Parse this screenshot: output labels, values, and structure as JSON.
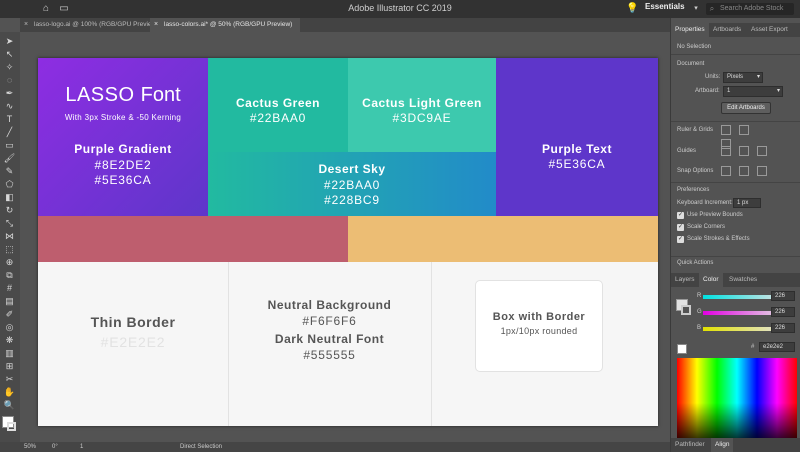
{
  "window": {
    "title": "Adobe Illustrator CC 2019",
    "workspace": "Essentials",
    "search_placeholder": "Search Adobe Stock"
  },
  "doc_tabs": [
    {
      "label": "lasso-logo.ai @ 100% (RGB/GPU Preview)",
      "active": false
    },
    {
      "label": "lasso-colors.ai* @ 50% (RGB/GPU Preview)",
      "active": true
    }
  ],
  "artboard": {
    "purple_gradient": {
      "logo": "LASSO Font",
      "logo_main": "LASSO",
      "logo_sub": "Font",
      "tagline": "With 3px Stroke & -50 Kerning",
      "label": "Purple Gradient",
      "hex1": "#8E2DE2",
      "hex2": "#5E36CA"
    },
    "cactus_green": {
      "label": "Cactus Green",
      "hex": "#22BAA0"
    },
    "cactus_light_green": {
      "label": "Cactus Light Green",
      "hex": "#3DC9AE"
    },
    "desert_sky": {
      "label": "Desert Sky",
      "hex1": "#22BAA0",
      "hex2": "#228BC9"
    },
    "purple_text": {
      "label": "Purple Text",
      "hex": "#5E36CA"
    },
    "thin_border": {
      "label": "Thin Border",
      "hex": "#E2E2E2"
    },
    "neutral": {
      "label1": "Neutral Background",
      "hex1": "#F6F6F6",
      "label2": "Dark Neutral Font",
      "hex2": "#555555"
    },
    "box_border": {
      "label": "Box with Border",
      "spec": "1px/10px rounded"
    }
  },
  "status": {
    "zoom": "50%",
    "angle": "0°",
    "artboard": "1",
    "tool": "Direct Selection"
  },
  "properties": {
    "tabs": [
      "Properties",
      "Artboards",
      "Asset Export"
    ],
    "selection": "No Selection",
    "document_heading": "Document",
    "units_label": "Units:",
    "units_value": "Pixels",
    "artboard_label": "Artboard:",
    "artboard_value": "1",
    "edit_artboards": "Edit Artboards",
    "rulers_grids": "Ruler & Grids",
    "guides": "Guides",
    "snap_options": "Snap Options",
    "preferences": "Preferences",
    "keyboard_increment_label": "Keyboard Increment:",
    "keyboard_increment_value": "1 px",
    "use_preview_bounds": "Use Preview Bounds",
    "scale_corners": "Scale Corners",
    "scale_strokes": "Scale Strokes & Effects",
    "quick_actions": "Quick Actions"
  },
  "color_panel": {
    "tabs": [
      "Layers",
      "Color",
      "Swatches"
    ],
    "channels": [
      {
        "name": "R",
        "value": "226",
        "color": "#e06060"
      },
      {
        "name": "G",
        "value": "226",
        "color": "#60c060"
      },
      {
        "name": "B",
        "value": "226",
        "color": "#8080e0"
      }
    ],
    "hex": "e2e2e2"
  },
  "bottom_tabs": [
    "Pathfinder",
    "Align"
  ],
  "colors": {
    "purple1": "#8E2DE2",
    "purple2": "#5E36CA",
    "green": "#22BAA0",
    "light_green": "#3DC9AE",
    "blue": "#228BC9",
    "border": "#E2E2E2",
    "bg": "#F6F6F6",
    "font": "#555555"
  }
}
